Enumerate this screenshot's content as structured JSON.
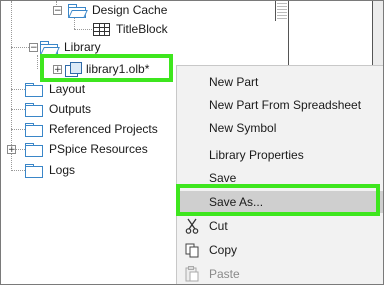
{
  "tree": {
    "design_cache": "Design Cache",
    "title_block": "TitleBlock",
    "library": "Library",
    "library_file": "library1.olb*",
    "layout": "Layout",
    "outputs": "Outputs",
    "referenced_projects": "Referenced Projects",
    "pspice_resources": "PSpice Resources",
    "logs": "Logs",
    "expand_symbol": "+",
    "collapse_symbol": "−"
  },
  "context_menu": {
    "items": [
      {
        "label": "New Part",
        "state": "normal"
      },
      {
        "label": "New Part From Spreadsheet",
        "state": "normal"
      },
      {
        "label": "New Symbol",
        "state": "normal"
      },
      {
        "label": "Library Properties",
        "state": "normal"
      },
      {
        "label": "Save",
        "state": "normal"
      },
      {
        "label": "Save As...",
        "state": "hover"
      },
      {
        "label": "Cut",
        "state": "normal",
        "icon": "scissors-icon"
      },
      {
        "label": "Copy",
        "state": "normal",
        "icon": "copy-icon"
      },
      {
        "label": "Paste",
        "state": "disabled",
        "icon": "paste-icon"
      }
    ]
  },
  "colors": {
    "highlight": "#3ee61e",
    "folder": "#3a86c8",
    "menu_bg": "#f2f2f2",
    "menu_hover": "#cfcfcf"
  }
}
